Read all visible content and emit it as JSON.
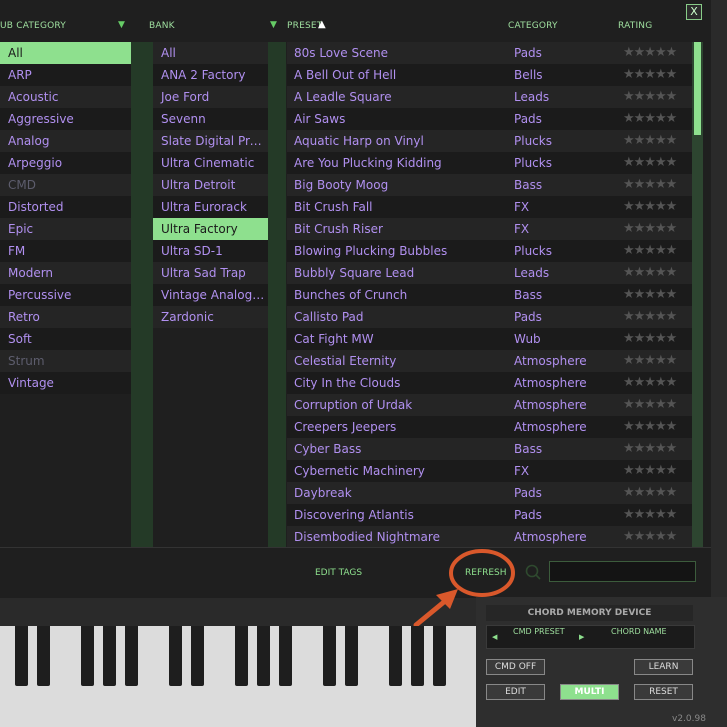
{
  "headers": {
    "sub_category": "UB CATEGORY",
    "bank": "BANK",
    "preset": "PRESET",
    "category": "CATEGORY",
    "rating": "RATING",
    "close": "X"
  },
  "sub_categories": [
    {
      "label": "All",
      "state": "selected"
    },
    {
      "label": "ARP",
      "state": "normal"
    },
    {
      "label": "Acoustic",
      "state": "normal"
    },
    {
      "label": "Aggressive",
      "state": "normal"
    },
    {
      "label": "Analog",
      "state": "normal"
    },
    {
      "label": "Arpeggio",
      "state": "normal"
    },
    {
      "label": "CMD",
      "state": "dim"
    },
    {
      "label": "Distorted",
      "state": "normal"
    },
    {
      "label": "Epic",
      "state": "normal"
    },
    {
      "label": "FM",
      "state": "normal"
    },
    {
      "label": "Modern",
      "state": "normal"
    },
    {
      "label": "Percussive",
      "state": "normal"
    },
    {
      "label": "Retro",
      "state": "normal"
    },
    {
      "label": "Soft",
      "state": "normal"
    },
    {
      "label": "Strum",
      "state": "dim"
    },
    {
      "label": "Vintage",
      "state": "normal"
    }
  ],
  "banks": [
    {
      "label": "All",
      "state": "normal"
    },
    {
      "label": "ANA 2 Factory",
      "state": "normal"
    },
    {
      "label": "Joe Ford",
      "state": "normal"
    },
    {
      "label": "Sevenn",
      "state": "normal"
    },
    {
      "label": "Slate Digital Presets",
      "state": "normal"
    },
    {
      "label": "Ultra Cinematic",
      "state": "normal"
    },
    {
      "label": "Ultra Detroit",
      "state": "normal"
    },
    {
      "label": "Ultra Eurorack",
      "state": "normal"
    },
    {
      "label": "Ultra Factory",
      "state": "selected"
    },
    {
      "label": "Ultra SD-1",
      "state": "normal"
    },
    {
      "label": "Ultra Sad Trap",
      "state": "normal"
    },
    {
      "label": "Vintage Analog C...",
      "state": "normal"
    },
    {
      "label": "Zardonic",
      "state": "normal"
    }
  ],
  "presets": [
    {
      "name": "80s Love Scene",
      "category": "Pads"
    },
    {
      "name": "A Bell Out of Hell",
      "category": "Bells"
    },
    {
      "name": "A Leadle Square",
      "category": "Leads"
    },
    {
      "name": "Air Saws",
      "category": "Pads"
    },
    {
      "name": "Aquatic Harp on Vinyl",
      "category": "Plucks"
    },
    {
      "name": "Are You Plucking Kidding",
      "category": "Plucks"
    },
    {
      "name": "Big Booty Moog",
      "category": "Bass"
    },
    {
      "name": "Bit Crush Fall",
      "category": "FX"
    },
    {
      "name": "Bit Crush Riser",
      "category": "FX"
    },
    {
      "name": "Blowing Plucking Bubbles",
      "category": "Plucks"
    },
    {
      "name": "Bubbly Square Lead",
      "category": "Leads"
    },
    {
      "name": "Bunches of Crunch",
      "category": "Bass"
    },
    {
      "name": "Callisto Pad",
      "category": "Pads"
    },
    {
      "name": "Cat Fight MW",
      "category": "Wub"
    },
    {
      "name": "Celestial Eternity",
      "category": "Atmosphere"
    },
    {
      "name": "City In the Clouds",
      "category": "Atmosphere"
    },
    {
      "name": "Corruption of Urdak",
      "category": "Atmosphere"
    },
    {
      "name": "Creepers Jeepers",
      "category": "Atmosphere"
    },
    {
      "name": "Cyber Bass",
      "category": "Bass"
    },
    {
      "name": "Cybernetic Machinery",
      "category": "FX"
    },
    {
      "name": "Daybreak",
      "category": "Pads"
    },
    {
      "name": "Discovering Atlantis",
      "category": "Pads"
    },
    {
      "name": "Disembodied Nightmare",
      "category": "Atmosphere"
    }
  ],
  "stars": "★★★★★",
  "bottom_bar": {
    "edit_tags": "EDIT TAGS",
    "refresh": "REFRESH",
    "search_value": ""
  },
  "chord_panel": {
    "title": "CHORD MEMORY DEVICE",
    "cmd_preset": "CMD PRESET",
    "chord_name": "CHORD NAME",
    "cmd_off": "CMD OFF",
    "learn": "LEARN",
    "edit": "EDIT",
    "multi": "MULTI",
    "reset": "RESET"
  },
  "version": "v2.0.98",
  "colors": {
    "accent_green": "#8ee08e",
    "preset_purple": "#b190f0",
    "annotation_orange": "#d9582b"
  }
}
